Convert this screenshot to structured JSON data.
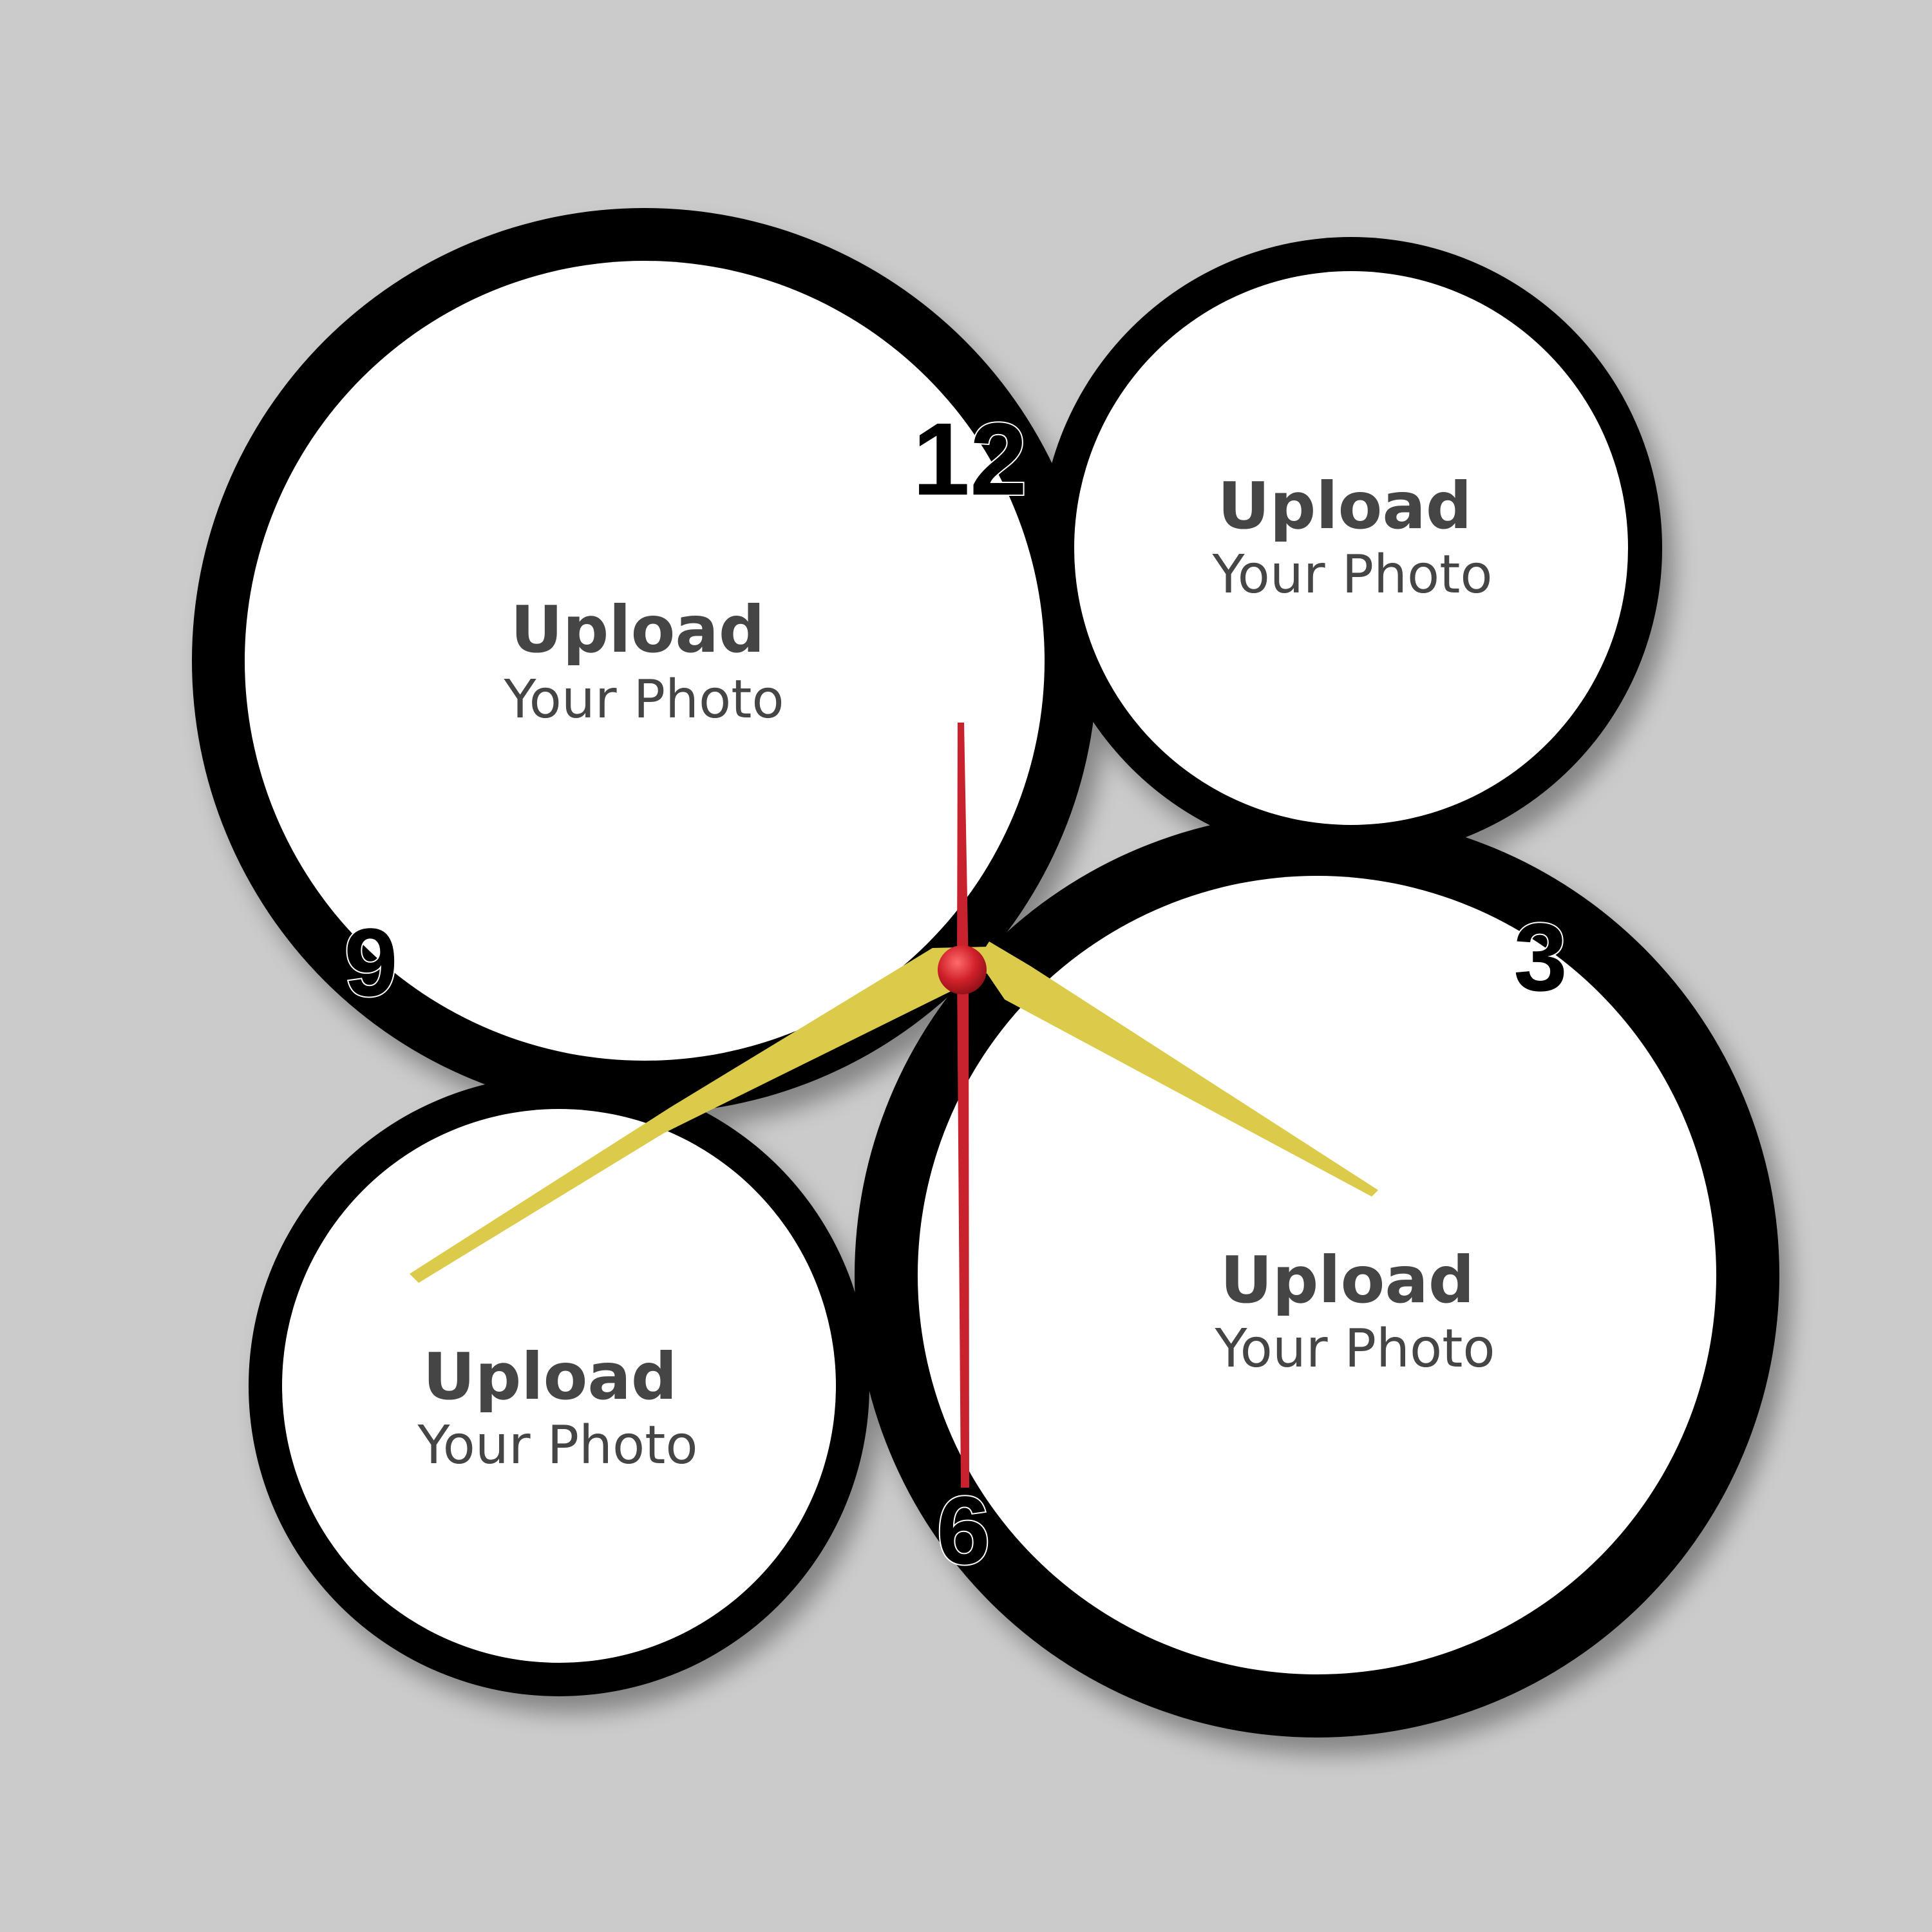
{
  "clock": {
    "numerals": {
      "twelve": "12",
      "three": "3",
      "six": "6",
      "nine": "9"
    },
    "photo_slots": [
      {
        "title": "Upload",
        "subtitle": "Your Photo"
      },
      {
        "title": "Upload",
        "subtitle": "Your Photo"
      },
      {
        "title": "Upload",
        "subtitle": "Your Photo"
      },
      {
        "title": "Upload",
        "subtitle": "Your Photo"
      }
    ],
    "colors": {
      "background": "#cbcbcb",
      "ring": "#000000",
      "slot_fill": "#ffffff",
      "slot_text": "#454545",
      "hour_minute_hands": "#dccb4b",
      "second_hand": "#c8222c",
      "center_cap": "#d0202a"
    }
  }
}
